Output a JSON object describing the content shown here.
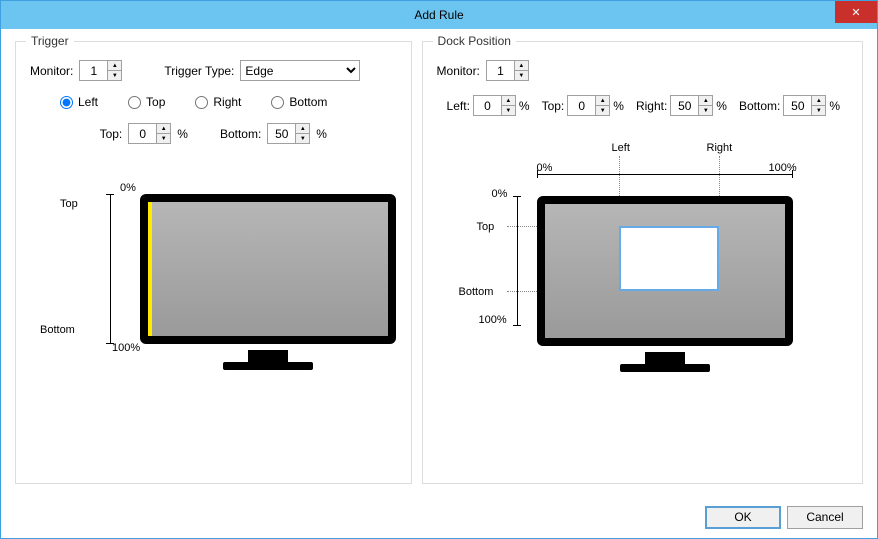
{
  "title": "Add Rule",
  "trigger": {
    "group_label": "Trigger",
    "monitor_label": "Monitor:",
    "monitor_value": "1",
    "type_label": "Trigger Type:",
    "type_value": "Edge",
    "edges": {
      "left": "Left",
      "top": "Top",
      "right": "Right",
      "bottom": "Bottom"
    },
    "top_label": "Top:",
    "top_value": "0",
    "bottom_label": "Bottom:",
    "bottom_value": "50",
    "pct_0": "0%",
    "pct_100": "100%",
    "axis_top": "Top",
    "axis_bottom": "Bottom"
  },
  "dock": {
    "group_label": "Dock Position",
    "monitor_label": "Monitor:",
    "monitor_value": "1",
    "left_label": "Left:",
    "left_value": "0",
    "top_label": "Top:",
    "top_value": "0",
    "right_label": "Right:",
    "right_value": "50",
    "bottom_label": "Bottom:",
    "bottom_value": "50",
    "pct_0": "0%",
    "pct_100": "100%",
    "axis_left": "Left",
    "axis_right": "Right",
    "axis_top": "Top",
    "axis_bottom": "Bottom"
  },
  "buttons": {
    "ok": "OK",
    "cancel": "Cancel"
  },
  "pct_sym": "%"
}
